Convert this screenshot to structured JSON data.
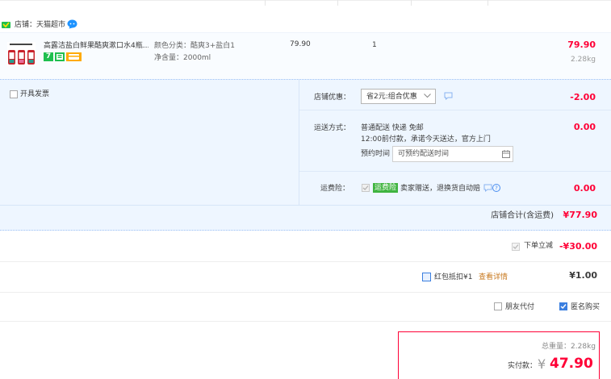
{
  "store": {
    "label": "店铺：",
    "name": "天猫超市"
  },
  "item": {
    "title": "高露洁盐白鲜果酷爽漱口水4瓶...",
    "badge_green": "7",
    "spec_label": "颜色分类：",
    "spec_value": "酷爽3+盐白1",
    "volume_label": "净含量：",
    "volume_value": "2000ml",
    "unit_price": "79.90",
    "quantity": "1",
    "subtotal": "79.90",
    "weight": "2.28kg"
  },
  "invoice": {
    "label": "开具发票"
  },
  "discount": {
    "label": "店铺优惠：",
    "selected": "省2元:组合优惠",
    "amount": "-2.00"
  },
  "shipping": {
    "label": "运送方式：",
    "line1": "普通配送 快递 免邮",
    "line2": "12:00前付款，承诺今天送达，官方上门",
    "appointment_label": "预约时间",
    "appointment_placeholder": "可预约配送时间",
    "amount": "0.00"
  },
  "freight_insurance": {
    "label": "运费险：",
    "tag": "运费险",
    "text": "卖家赠送，退换货自动赔",
    "amount": "0.00"
  },
  "store_total": {
    "label": "店铺合计(含运费)",
    "amount": "¥77.90"
  },
  "order_discount": {
    "label": "下单立减",
    "amount": "-¥30.00"
  },
  "red_packet": {
    "label": "红包抵扣¥1",
    "link": "查看详情",
    "amount": "¥1.00"
  },
  "options": {
    "friend_pay": "朋友代付",
    "anonymous": "匿名购买"
  },
  "summary": {
    "weight_label": "总重量：",
    "weight_value": "2.28kg",
    "pay_label": "实付款：",
    "currency": "¥",
    "pay_amount": "47.90"
  },
  "colors": {
    "accent_red": "#ff0036",
    "panel_bg": "#eef6ff",
    "panel_border": "#b2d1ff",
    "green": "#0ec25c"
  }
}
